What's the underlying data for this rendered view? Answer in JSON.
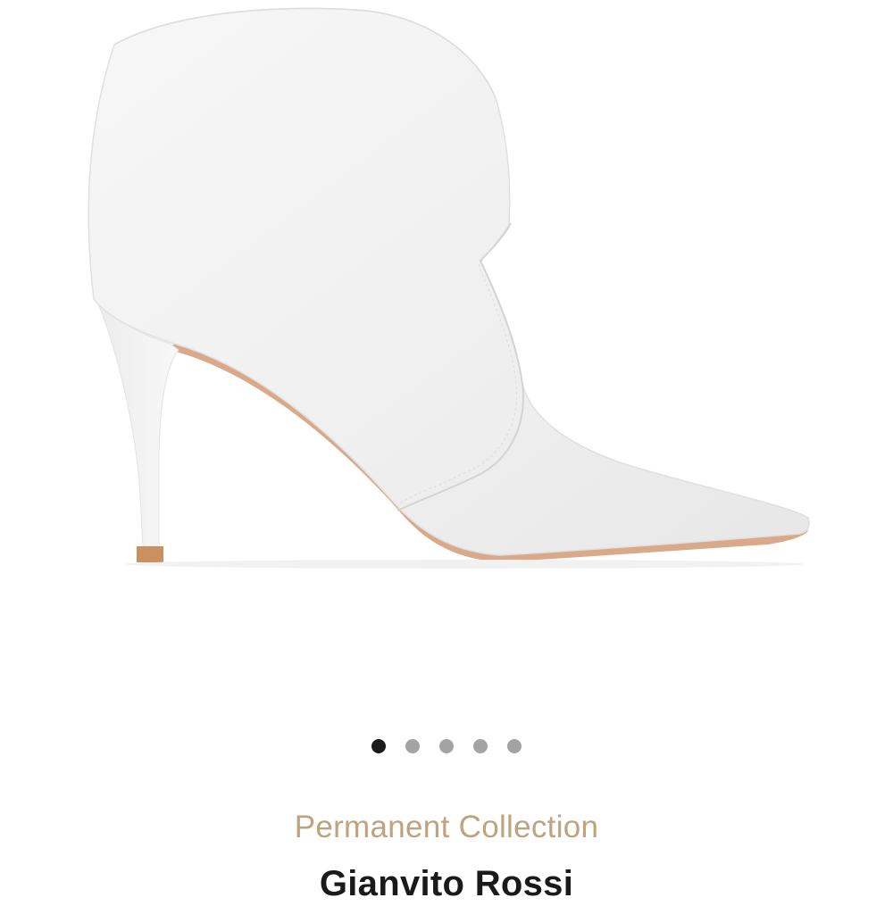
{
  "product": {
    "image_alt": "White leather pointed-toe ankle boot with stiletto heel",
    "collection": "Permanent Collection",
    "brand": "Gianvito Rossi"
  },
  "carousel": {
    "active_index": 0,
    "dot_count": 5
  },
  "colors": {
    "collection_label": "#bfa37e",
    "brand_name": "#1a1a1a",
    "dot_active": "#1c1c1c",
    "dot_inactive": "#a3a3a3",
    "boot_leather": "#f3f3f3",
    "sole_edge": "#d9a98a"
  }
}
